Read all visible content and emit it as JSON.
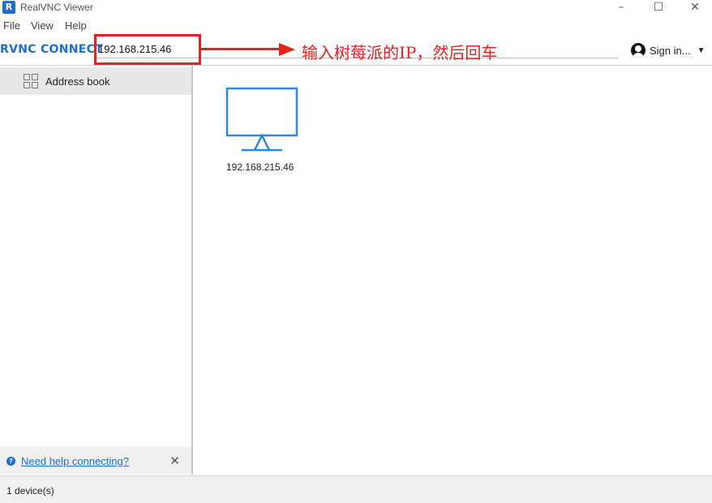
{
  "window": {
    "title": "RealVNC Viewer",
    "app_icon": "realvnc-logo-icon"
  },
  "menu": {
    "items": [
      "File",
      "View",
      "Help"
    ]
  },
  "toolbar": {
    "logo": "RVNC CONNECT",
    "address_value": "192.168.215.46",
    "signin_label": "Sign in...",
    "annotation": "输入树莓派的IP，然后回车"
  },
  "sidebar": {
    "items": [
      {
        "label": "Address book",
        "icon": "grid-icon"
      }
    ],
    "help_link": "Need help connecting?"
  },
  "content": {
    "devices": [
      {
        "label": "192.168.215.46",
        "icon": "monitor-icon"
      }
    ]
  },
  "status": {
    "text": "1 device(s)"
  },
  "colors": {
    "accent": "#1e6fd0",
    "annotation": "#ea1f1f"
  }
}
